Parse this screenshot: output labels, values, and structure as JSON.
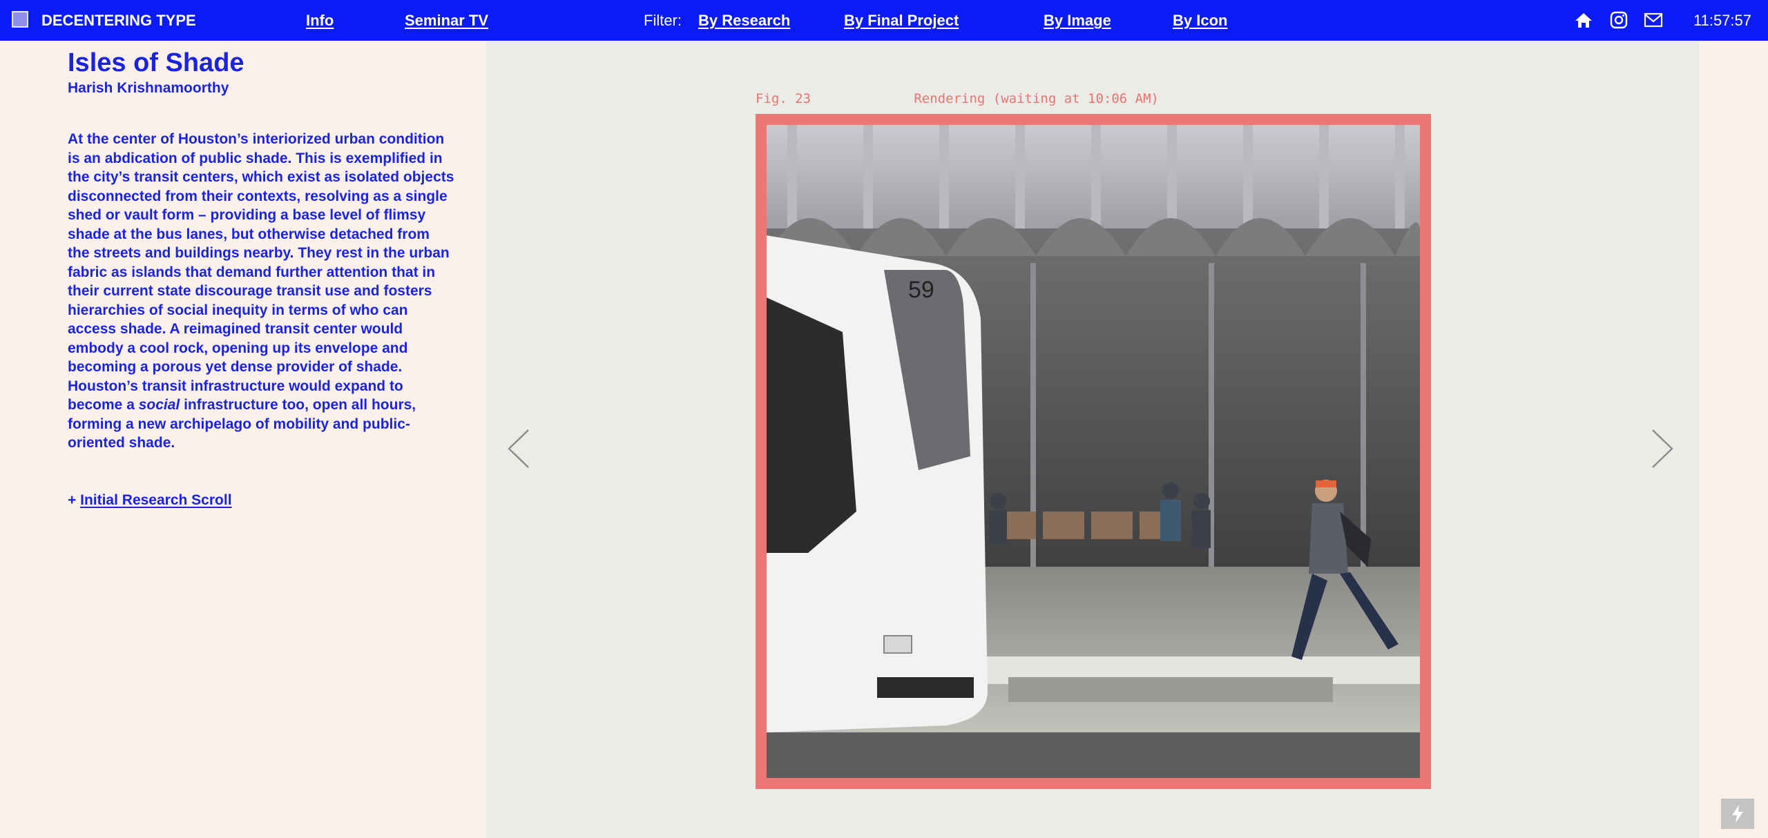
{
  "header": {
    "site_title": "DECENTERING TYPE",
    "nav_info": "Info",
    "nav_seminar": "Seminar TV",
    "filter_label": "Filter:",
    "filters": [
      "By Research",
      "By Final Project",
      "By Image",
      "By Icon"
    ],
    "icons": [
      "home-icon",
      "instagram-icon",
      "mail-icon"
    ],
    "clock": "11:57:57"
  },
  "project": {
    "title": "Isles of Shade",
    "author": "Harish Krishnamoorthy",
    "description_part1": "At the center of Houston’s interiorized urban condition is an abdication of public shade. This is exemplified in the city’s transit centers, which exist as isolated objects disconnected from their contexts, resolving as a single shed or vault form – providing a base level of flimsy shade at the bus lanes, but otherwise detached from the streets and buildings nearby. They rest in the urban fabric as islands that demand further attention that in their current state discourage transit use and fosters hierarchies of social inequity in terms of who can access shade. A reimagined transit center would embody a cool rock, opening up its envelope and becoming a porous yet dense provider of shade. Houston’s transit infrastructure would expand to become a ",
    "description_emphasis": "social",
    "description_part2": " infrastructure too, open all hours, forming a new archipelago of mobility and public-oriented shade.",
    "link_prefix": "+",
    "link_label": "Initial Research Scroll"
  },
  "viewer": {
    "figure_label": "Fig. 23",
    "status_label": "Rendering (waiting at 10:06 AM)",
    "image_subject": "transit center rendering with bus and pedestrians",
    "frame_color": "#ed7773"
  },
  "colors": {
    "accent": "#0b1bf5",
    "text": "#1a24e0",
    "background": "#fbf1ea",
    "viewer_bg": "#ebebe8"
  }
}
